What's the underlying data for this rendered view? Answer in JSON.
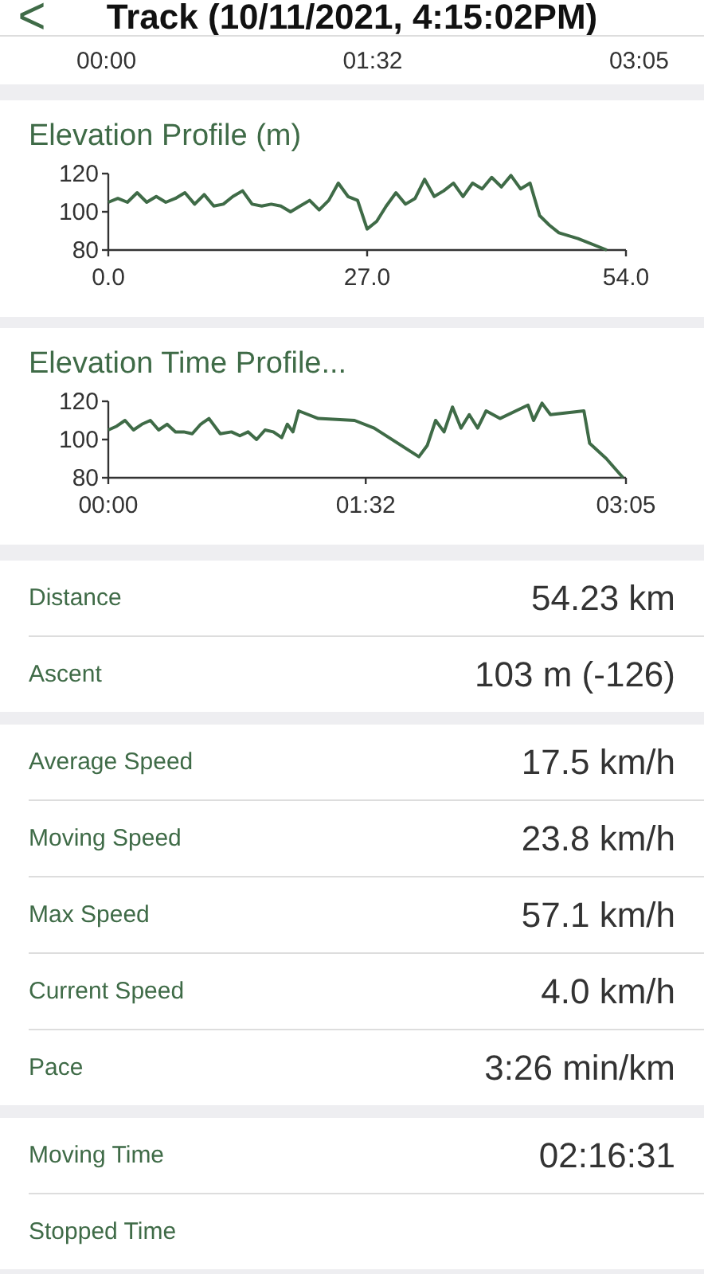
{
  "header": {
    "back": "<",
    "title": "Track (10/11/2021, 4:15:02PM)"
  },
  "previous_chart_axis": [
    "00:00",
    "01:32",
    "03:05"
  ],
  "charts": [
    {
      "title": "Elevation Profile (m)",
      "chart_data": {
        "type": "line",
        "x": [
          0,
          1,
          2,
          3,
          4,
          5,
          6,
          7,
          8,
          9,
          10,
          11,
          12,
          13,
          14,
          15,
          16,
          17,
          18,
          19,
          20,
          21,
          22,
          23,
          24,
          25,
          26,
          27,
          28,
          29,
          30,
          31,
          32,
          33,
          34,
          35,
          36,
          37,
          38,
          39,
          40,
          41,
          42,
          43,
          44,
          45,
          46,
          47,
          49,
          52
        ],
        "series": [
          {
            "color": "#3f6b47",
            "values": [
              105,
              107,
              105,
              110,
              105,
              108,
              105,
              107,
              110,
              104,
              109,
              103,
              104,
              108,
              111,
              104,
              103,
              104,
              103,
              100,
              103,
              106,
              101,
              106,
              115,
              108,
              106,
              91,
              95,
              103,
              110,
              104,
              107,
              117,
              108,
              111,
              115,
              108,
              115,
              112,
              118,
              113,
              119,
              112,
              115,
              98,
              93,
              89,
              86,
              80
            ]
          }
        ],
        "xlim": [
          0,
          54
        ],
        "ylim": [
          80,
          120
        ],
        "xticks": [
          {
            "value": 0,
            "label": "0.0"
          },
          {
            "value": 27,
            "label": "27.0"
          },
          {
            "value": 54,
            "label": "54.0"
          }
        ],
        "yticks": [
          80,
          100,
          120
        ]
      }
    },
    {
      "title": "Elevation Time Profile...",
      "chart_data": {
        "type": "line",
        "x": [
          0,
          3,
          6,
          9,
          12,
          15,
          18,
          21,
          24,
          27,
          30,
          33,
          36,
          40,
          44,
          47,
          50,
          53,
          56,
          59,
          62,
          64,
          66,
          68,
          75,
          88,
          95,
          111,
          114,
          117,
          120,
          123,
          126,
          129,
          132,
          135,
          140,
          150,
          152,
          155,
          158,
          170,
          172,
          178,
          184
        ],
        "series": [
          {
            "color": "#3f6b47",
            "values": [
              105,
              107,
              110,
              105,
              108,
              110,
              105,
              108,
              104,
              104,
              103,
              108,
              111,
              103,
              104,
              102,
              104,
              100,
              105,
              104,
              101,
              108,
              104,
              115,
              111,
              110,
              106,
              91,
              97,
              110,
              104,
              117,
              106,
              113,
              106,
              115,
              111,
              118,
              110,
              119,
              113,
              115,
              98,
              90,
              80
            ]
          }
        ],
        "xlim": [
          0,
          185
        ],
        "ylim": [
          80,
          120
        ],
        "xticks": [
          {
            "value": 0,
            "label": "00:00"
          },
          {
            "value": 92,
            "label": "01:32"
          },
          {
            "value": 185,
            "label": "03:05"
          }
        ],
        "yticks": [
          80,
          100,
          120
        ]
      }
    }
  ],
  "stat_groups": [
    [
      {
        "label": "Distance",
        "value": "54.23 km"
      },
      {
        "label": "Ascent",
        "value": "103 m (-126)"
      }
    ],
    [
      {
        "label": "Average Speed",
        "value": "17.5 km/h"
      },
      {
        "label": "Moving Speed",
        "value": "23.8 km/h"
      },
      {
        "label": "Max Speed",
        "value": "57.1 km/h"
      },
      {
        "label": "Current Speed",
        "value": "4.0 km/h"
      },
      {
        "label": "Pace",
        "value": "3:26 min/km"
      }
    ],
    [
      {
        "label": "Moving Time",
        "value": "02:16:31"
      },
      {
        "label": "Stopped Time"
      }
    ]
  ]
}
